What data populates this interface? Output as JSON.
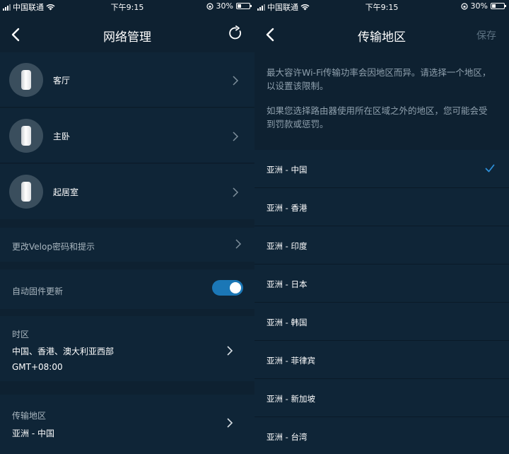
{
  "status_bar_left": {
    "carrier": "中国联通",
    "time": "下午9:15",
    "battery": "30%"
  },
  "status_bar_right": {
    "carrier": "中国联通",
    "time": "下午9:15",
    "battery": "30%"
  },
  "left_screen": {
    "title": "网络管理",
    "nodes": [
      {
        "label": "客厅"
      },
      {
        "label": "主卧"
      },
      {
        "label": "起居室"
      }
    ],
    "change_password": "更改Velop密码和提示",
    "auto_update": {
      "label": "自动固件更新",
      "enabled": true
    },
    "timezone": {
      "header": "时区",
      "value": "中国、香港、澳大利亚西部",
      "offset": "GMT+08:00"
    },
    "region": {
      "header": "传输地区",
      "value": "亚洲 - 中国"
    }
  },
  "right_screen": {
    "title": "传输地区",
    "save_label": "保存",
    "desc1": "最大容许Wi-Fi传输功率会因地区而异。请选择一个地区，以设置该限制。",
    "desc2": "如果您选择路由器使用所在区域之外的地区，您可能会受到罚款或惩罚。",
    "regions": [
      {
        "label": "亚洲 - 中国",
        "selected": true
      },
      {
        "label": "亚洲 - 香港",
        "selected": false
      },
      {
        "label": "亚洲 - 印度",
        "selected": false
      },
      {
        "label": "亚洲 - 日本",
        "selected": false
      },
      {
        "label": "亚洲 - 韩国",
        "selected": false
      },
      {
        "label": "亚洲 - 菲律宾",
        "selected": false
      },
      {
        "label": "亚洲 - 新加坡",
        "selected": false
      },
      {
        "label": "亚洲 - 台湾",
        "selected": false
      }
    ]
  },
  "colors": {
    "background": "#0e2131",
    "row": "#0f2537",
    "accent": "#1b77b6",
    "check": "#2d8fd8",
    "muted_text": "#8fa0ad"
  }
}
